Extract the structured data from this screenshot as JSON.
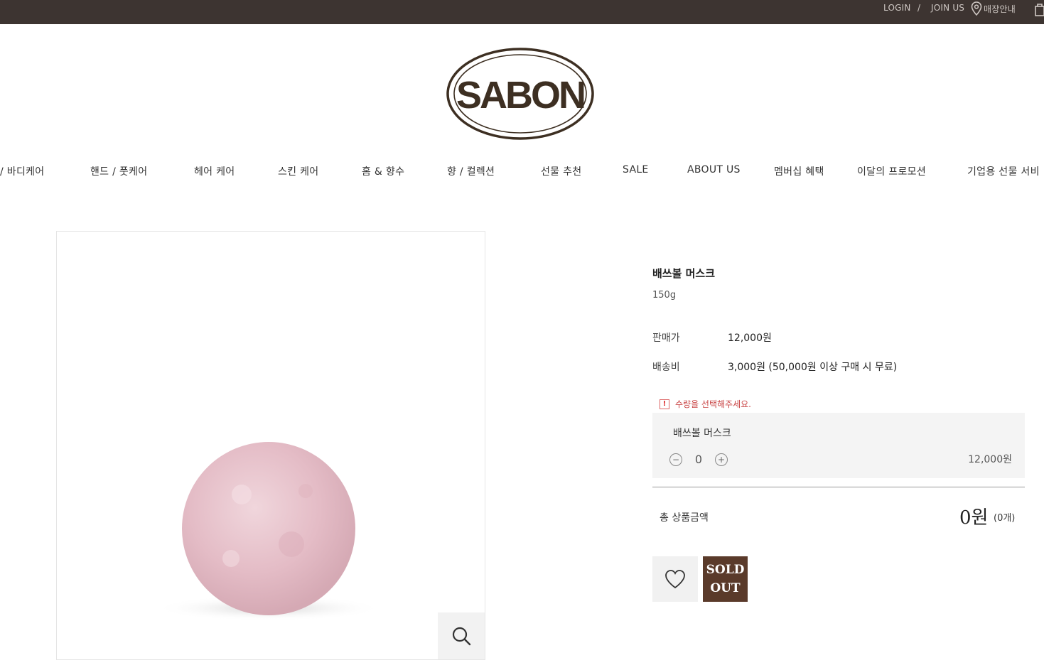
{
  "topbar": {
    "login": "LOGIN",
    "separator": "/",
    "join": "JOIN US",
    "store": "매장안내",
    "icons": [
      "location-pin-icon",
      "shopping-bag-icon"
    ]
  },
  "logo": {
    "text": "SABON",
    "color": "#3d2f22"
  },
  "nav": {
    "items": [
      "/ 바디케어",
      "핸드 / 풋케어",
      "헤어 케어",
      "스킨 케어",
      "홈 & 향수",
      "향 / 컬렉션",
      "선물 추천",
      "SALE",
      "ABOUT US",
      "멤버십 혜택",
      "이달의 프로모션",
      "기업용 선물 서비"
    ]
  },
  "product": {
    "name": "배쓰볼 머스크",
    "weight": "150g",
    "price_label": "판매가",
    "price_value": "12,000원",
    "shipping_label": "배송비",
    "shipping_value": "3,000원 (50,000원 이상 구매 시 무료)",
    "warning": "수량을 선택해주세요.",
    "option": {
      "name": "배쓰볼 머스크",
      "quantity": "0",
      "price": "12,000원"
    },
    "total_label": "총 상품금액",
    "total_amount": "0원",
    "total_count": "(0개)",
    "soldout_line1": "SOLD",
    "soldout_line2": "OUT"
  },
  "colors": {
    "topbar_bg": "#3d3431",
    "soldout_bg": "#5a3a2a",
    "warning": "#c94545",
    "ball": "#e7c3cc"
  }
}
